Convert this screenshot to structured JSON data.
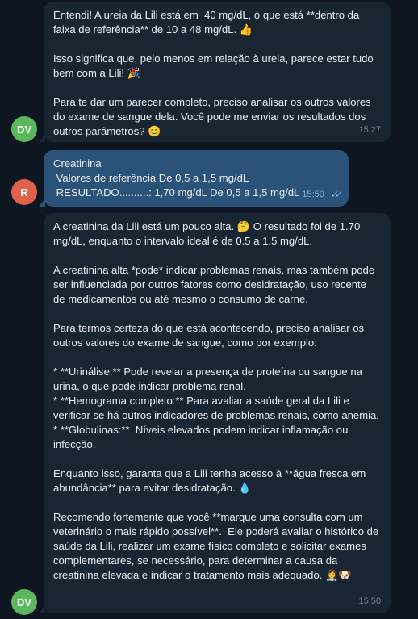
{
  "messages": [
    {
      "sender_initials": "DV",
      "avatar_color": "#5cb85c",
      "paragraphs": [
        "Entendi! A ureia da Lili está em  40 mg/dL, o que está **dentro da faixa de referência** de 10 a 48 mg/dL. 👍",
        "Isso significa que, pelo menos em relação à ureia, parece estar tudo bem com a Lili! 🎉",
        "Para te dar um parecer completo, preciso analisar os outros valores do exame de sangue dela. Você pode me enviar os resultados dos outros parâmetros? 😊"
      ],
      "time": "15:27"
    },
    {
      "sender_initials": "R",
      "avatar_color": "#e0614a",
      "lines": [
        "Creatinina",
        " Valores de referência De 0,5 a 1,5 mg/dL",
        " RESULTADO..........: 1,70 mg/dL De 0,5 a 1,5 mg/dL"
      ],
      "time": "15:50",
      "status": "read"
    },
    {
      "sender_initials": "DV",
      "avatar_color": "#5cb85c",
      "paragraphs": [
        "A creatinina da Lili está um pouco alta. 🤔 O resultado foi de 1.70 mg/dL, enquanto o intervalo ideal é de 0.5 a 1.5 mg/dL.",
        "A creatinina alta *pode* indicar problemas renais, mas também pode ser influenciada por outros fatores como desidratação, uso recente de medicamentos ou até mesmo o consumo de carne.",
        "Para termos certeza do que está acontecendo, preciso analisar os outros valores do exame de sangue, como por exemplo:",
        "* **Urinálise:** Pode revelar a presença de proteína ou sangue na urina, o que pode indicar problema renal.\n* **Hemograma completo:** Para avaliar a saúde geral da Lili e verificar se há outros indicadores de problemas renais, como anemia.\n* **Globulinas:**  Níveis elevados podem indicar inflamação ou infecção.",
        "Enquanto isso, garanta que a Lili tenha acesso à **água fresca em abundância** para evitar desidratação. 💧",
        "Recomendo fortemente que você **marque uma consulta com um veterinário o mais rápido possível**.  Ele poderá avaliar o histórico de saúde da Lili, realizar um exame físico completo e solicitar exames complementares, se necessário, para determinar a causa da creatinina elevada e indicar o tratamento mais adequado. 👩‍⚕️🐶"
      ],
      "time": "15:50"
    }
  ]
}
